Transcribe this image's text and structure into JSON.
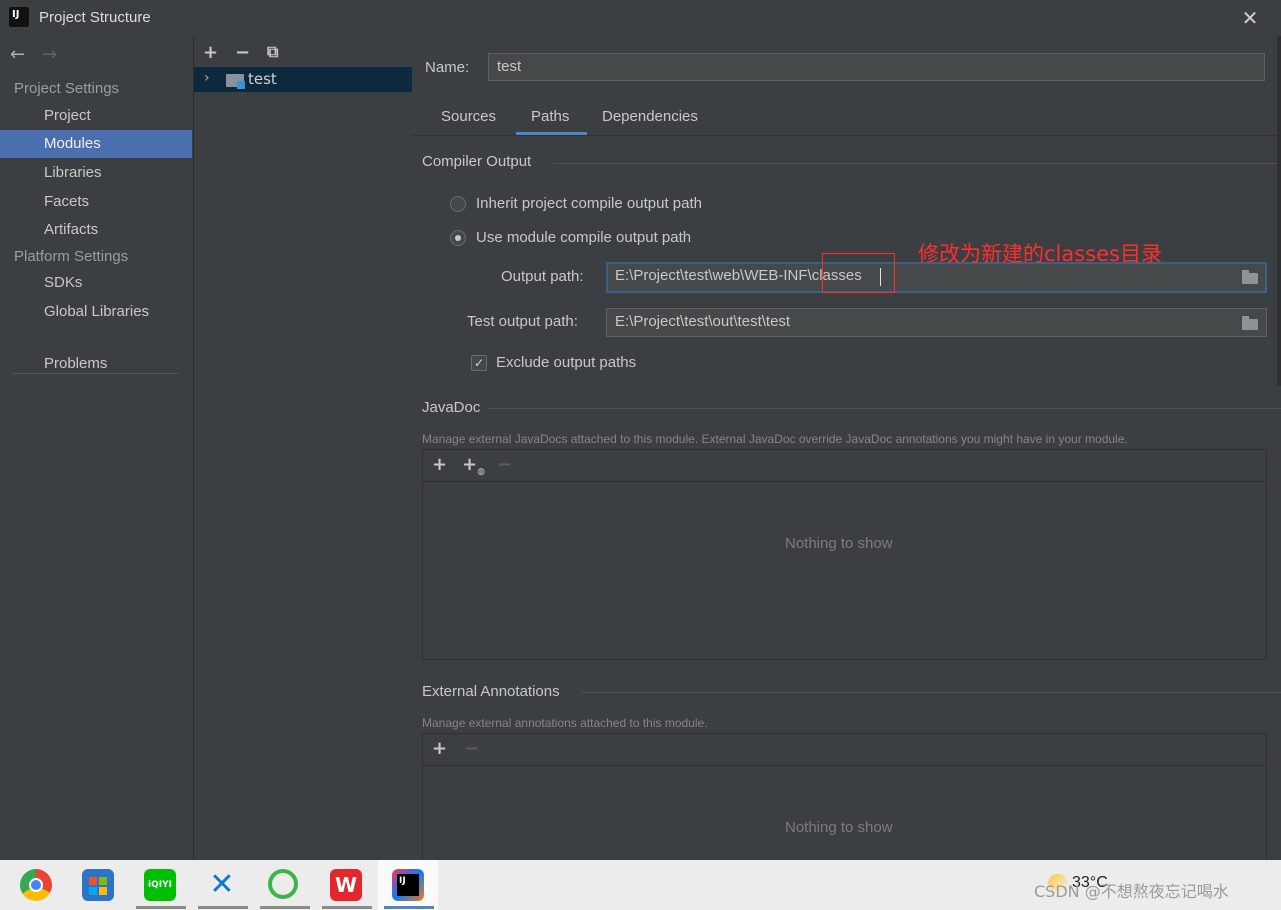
{
  "window": {
    "title": "Project Structure",
    "close_glyph": "✕"
  },
  "nav": {
    "back_glyph": "←",
    "forward_glyph": "→",
    "project_settings_header": "Project Settings",
    "project_settings_items": [
      "Project",
      "Modules",
      "Libraries",
      "Facets",
      "Artifacts"
    ],
    "platform_settings_header": "Platform Settings",
    "platform_settings_items": [
      "SDKs",
      "Global Libraries"
    ],
    "problems": "Problems",
    "selected": "Modules"
  },
  "tree": {
    "add_glyph": "+",
    "remove_glyph": "−",
    "copy_glyph": "⧉",
    "chevron": "›",
    "module_name": "test"
  },
  "module": {
    "name_label": "Name:",
    "name_value": "test",
    "tabs": [
      "Sources",
      "Paths",
      "Dependencies"
    ],
    "active_tab": "Paths"
  },
  "compiler_output": {
    "title": "Compiler Output",
    "inherit_label": "Inherit project compile output path",
    "use_module_label": "Use module compile output path",
    "selected_option": "use_module",
    "output_path_label": "Output path:",
    "output_path_value": "E:\\Project\\test\\web\\WEB-INF\\classes",
    "test_output_path_label": "Test output path:",
    "test_output_path_value": "E:\\Project\\test\\out\\test\\test",
    "exclude_label": "Exclude output paths",
    "exclude_checked": true
  },
  "javadoc": {
    "title": "JavaDoc",
    "description": "Manage external JavaDocs attached to this module. External JavaDoc override JavaDoc annotations you might have in your module.",
    "add_glyph": "+",
    "add_url_glyph": "+",
    "remove_glyph": "−",
    "empty_text": "Nothing to show"
  },
  "external_annotations": {
    "title": "External Annotations",
    "description": "Manage external annotations attached to this module.",
    "add_glyph": "+",
    "remove_glyph": "−",
    "empty_text": "Nothing to show"
  },
  "annotation": {
    "text": "修改为新建的classes目录",
    "color": "#ff2d2d"
  },
  "taskbar": {
    "apps": [
      "chrome-icon",
      "store-icon",
      "iqiyi-icon",
      "vscode-icon",
      "navicat-icon",
      "wps-icon",
      "intellij-icon"
    ],
    "iqiyi_label": "iQIYI",
    "intellij_label": "IJ",
    "temperature": "33°C",
    "watermark": "CSDN @不想熬夜忘记喝水"
  },
  "colors": {
    "selection": "#4b6eaf",
    "tab_underline": "#4a88c7",
    "background": "#3c3f41"
  }
}
